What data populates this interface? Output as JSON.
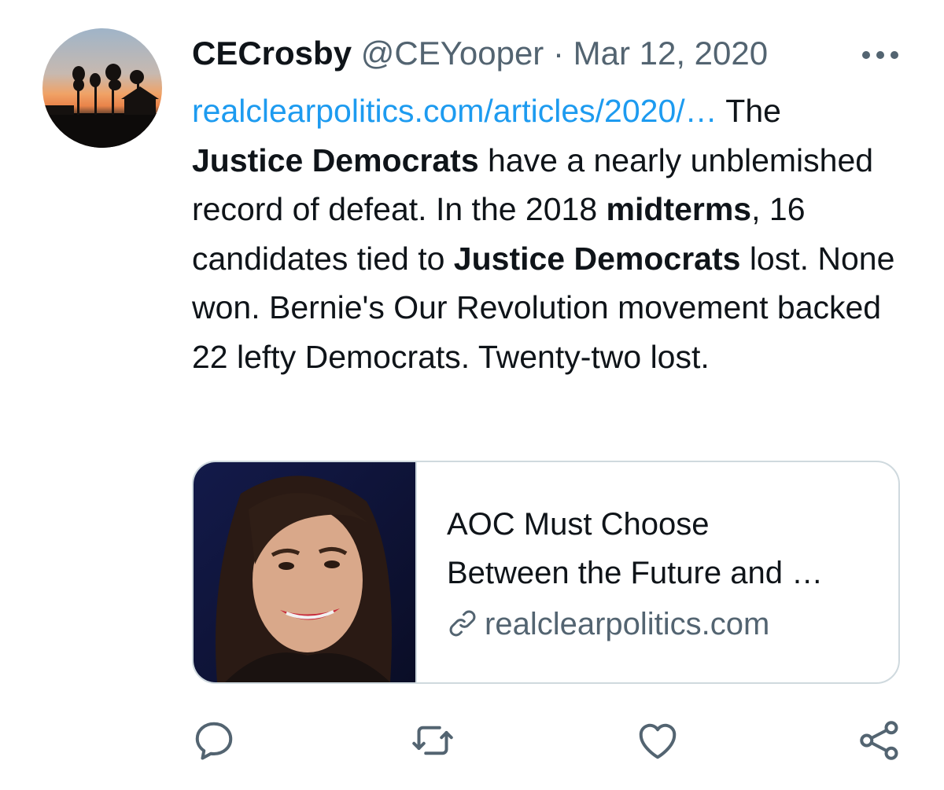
{
  "tweet": {
    "author_name": "CECrosby",
    "author_handle": "@CEYooper",
    "separator": " · ",
    "date": "Mar 12, 2020",
    "more_icon": "more-horizontal-icon",
    "body": {
      "link": "realclearpolitics.com/articles/2020/…",
      "t1": " The ",
      "b1": "Justice Democrats",
      "t2": " have a nearly unblemished record of defeat. In the 2018 ",
      "b2": "midterms",
      "t3": ", 16 candidates tied to ",
      "b3": "Justice Democrats",
      "t4": " lost. None won. Bernie's Our Revolution movement backed 22 lefty Democrats. Twenty-two lost."
    }
  },
  "card": {
    "title_line1": "AOC Must Choose",
    "title_line2": "Between the Future and …",
    "domain": "realclearpolitics.com",
    "domain_icon": "link-icon"
  },
  "actions": {
    "reply_icon": "reply-icon",
    "retweet_icon": "retweet-icon",
    "like_icon": "heart-icon",
    "share_icon": "share-icon"
  },
  "colors": {
    "link": "#1d9bf0",
    "text": "#0f1419",
    "secondary": "#536471",
    "border": "#cfd9de"
  }
}
